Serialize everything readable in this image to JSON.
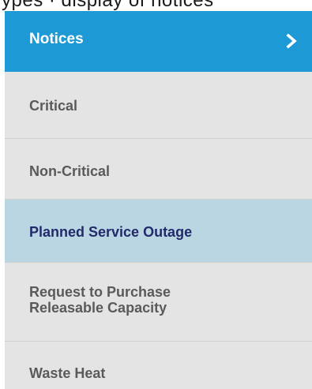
{
  "menu": {
    "header": {
      "label": "Notices",
      "icon": "chevron-right-icon",
      "background": "#1d9ad6"
    },
    "items": [
      {
        "label": "Critical",
        "active": false
      },
      {
        "label": "Non-Critical",
        "active": false
      },
      {
        "label": "Planned Service Outage",
        "active": true
      },
      {
        "label": "Request to Purchase",
        "label_line2": "Releasable Capacity",
        "active": false
      },
      {
        "label": "Waste Heat",
        "active": false
      }
    ],
    "active_background": "#b9d6e2",
    "active_text_color": "#232a6a",
    "text_color": "#5a5a5a"
  }
}
